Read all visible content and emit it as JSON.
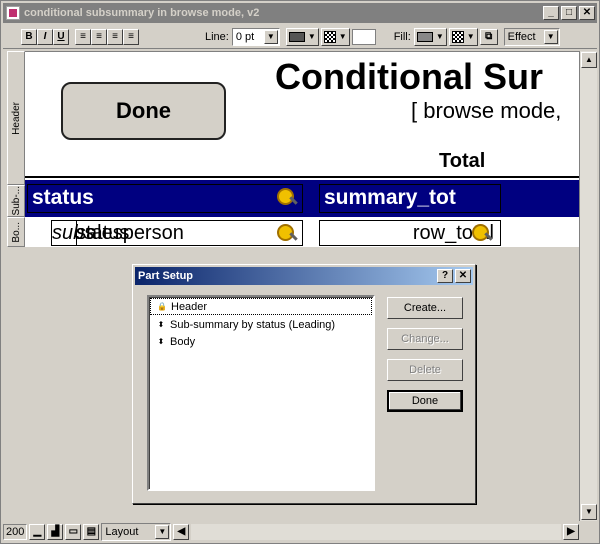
{
  "window": {
    "title": "conditional subsummary in browse mode, v2",
    "min": "_",
    "max": "□",
    "close": "✕"
  },
  "toolbar": {
    "bold": "B",
    "italic": "I",
    "underline": "U",
    "line_label": "Line:",
    "line_value": "0 pt",
    "fill_label": "Fill:",
    "effect_value": "Effect"
  },
  "parts_column": {
    "header": "Header",
    "subsummary": "Sub-...",
    "body": "Bo..."
  },
  "layout": {
    "done_button": "Done",
    "title": "Conditional Sur",
    "subtitle": "[ browse mode,",
    "total_label": "Total",
    "field_status": "status",
    "field_summary": "summary_tot",
    "body_field_1a": "subs",
    "body_field_1b": "salesperson",
    "body_field_1c": "status",
    "body_field_2": "row_total"
  },
  "statusbar": {
    "zoom": "200",
    "mode": "Layout"
  },
  "dialog": {
    "title": "Part Setup",
    "help": "?",
    "close": "✕",
    "parts": [
      {
        "label": "Header",
        "icon": "lock-icon"
      },
      {
        "label": "Sub-summary by status (Leading)",
        "icon": "updown-arrows-icon"
      },
      {
        "label": "Body",
        "icon": "updown-arrows-icon"
      }
    ],
    "buttons": {
      "create": "Create...",
      "change": "Change...",
      "delete": "Delete",
      "done": "Done"
    }
  },
  "colors": {
    "band": "#000080",
    "title_gradient_start": "#0a246a",
    "title_gradient_end": "#a6caf0"
  }
}
